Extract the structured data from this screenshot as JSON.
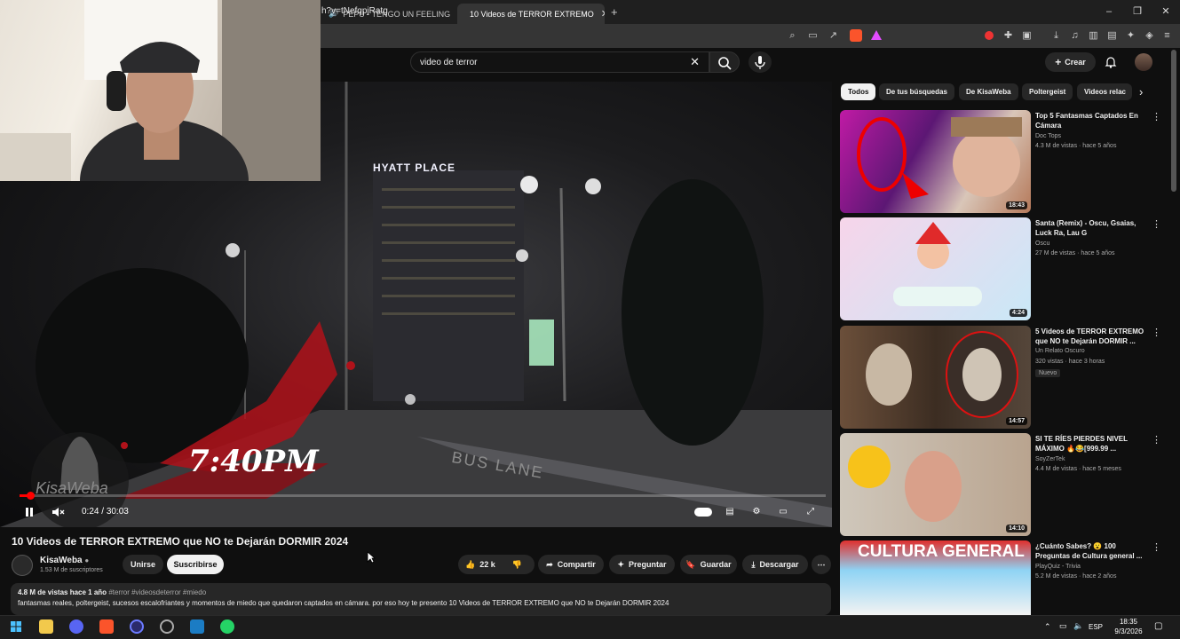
{
  "browser": {
    "tabs": [
      {
        "label": "PEPU - TENGO UN FEELING (Visu",
        "audio": true
      },
      {
        "label": "10 Videos de TERROR EXTREMO",
        "active": true
      }
    ],
    "new_tab": "+",
    "url": "h?v=tNefqpjRatg",
    "window_controls": {
      "minimize": "–",
      "maximize": "❐",
      "close": "✕"
    }
  },
  "youtube": {
    "search_value": "video de terror",
    "create_label": "Crear",
    "video": {
      "overlay_time_text": "7:40PM",
      "hotel_sign": "HYATT PLACE",
      "watermark": "KisaWeba",
      "road_text": "BUS LANE",
      "time_current": "0:24",
      "time_total": "30:03",
      "progress_fraction": 0.013
    },
    "title": "10 Videos de TERROR EXTREMO que NO te Dejarán DORMIR 2024",
    "channel": {
      "name": "KisaWeba",
      "subscribers": "1.53 M de suscriptores"
    },
    "buttons": {
      "join": "Unirse",
      "subscribe": "Suscribirse",
      "likes": "22 k",
      "share": "Compartir",
      "ask": "Preguntar",
      "save": "Guardar",
      "download": "Descargar"
    },
    "description": {
      "views": "4.8 M de vistas",
      "date": "hace 1 año",
      "tags": "#terror #videosdeterror #miedo",
      "text": "fantasmas reales, poltergeist, sucesos escalofriantes y momentos de miedo que quedaron captados en cámara. por eso hoy te presento 10 Videos de TERROR EXTREMO que NO te Dejarán DORMIR 2024"
    },
    "chips": [
      "Todos",
      "De tus búsquedas",
      "De KisaWeba",
      "Poltergeist",
      "Videos relac"
    ],
    "related": [
      {
        "title": "Top 5 Fantasmas Captados En Cámara",
        "channel": "Doc Tops",
        "meta": "4.3 M de vistas · hace 5 años",
        "duration": "18:43",
        "badge": ""
      },
      {
        "title": "Santa (Remix) - Oscu, Gsaias, Luck Ra, Lau G",
        "channel": "Oscu",
        "meta": "27 M de vistas · hace 5 años",
        "duration": "4:24",
        "badge": ""
      },
      {
        "title": "5 Videos de TERROR EXTREMO que NO te Dejarán DORMIR ...",
        "channel": "Un Relato Oscuro",
        "meta": "320 vistas · hace 3 horas",
        "duration": "14:57",
        "badge": "Nuevo"
      },
      {
        "title": "SI TE RÍES PIERDES NIVEL MÁXIMO 🔥😂[999.99 ...",
        "channel": "SoyZerTek",
        "meta": "4.4 M de vistas · hace 5 meses",
        "duration": "14:10",
        "badge": ""
      },
      {
        "title": "¿Cuánto Sabes? 😮 100 Preguntas de Cultura general ...",
        "channel": "PlayQuiz - Trivia",
        "meta": "5.2 M de vistas · hace 2 años",
        "duration": "",
        "badge": "",
        "thumb_text": "CULTURA GENERAL"
      }
    ]
  },
  "taskbar": {
    "lang": "ESP",
    "time": "18:35",
    "date": "9/3/2026"
  },
  "colors": {
    "yt_red": "#ff0000",
    "bg": "#0f0f0f",
    "chip": "#272727",
    "blood": "#b0121a"
  }
}
